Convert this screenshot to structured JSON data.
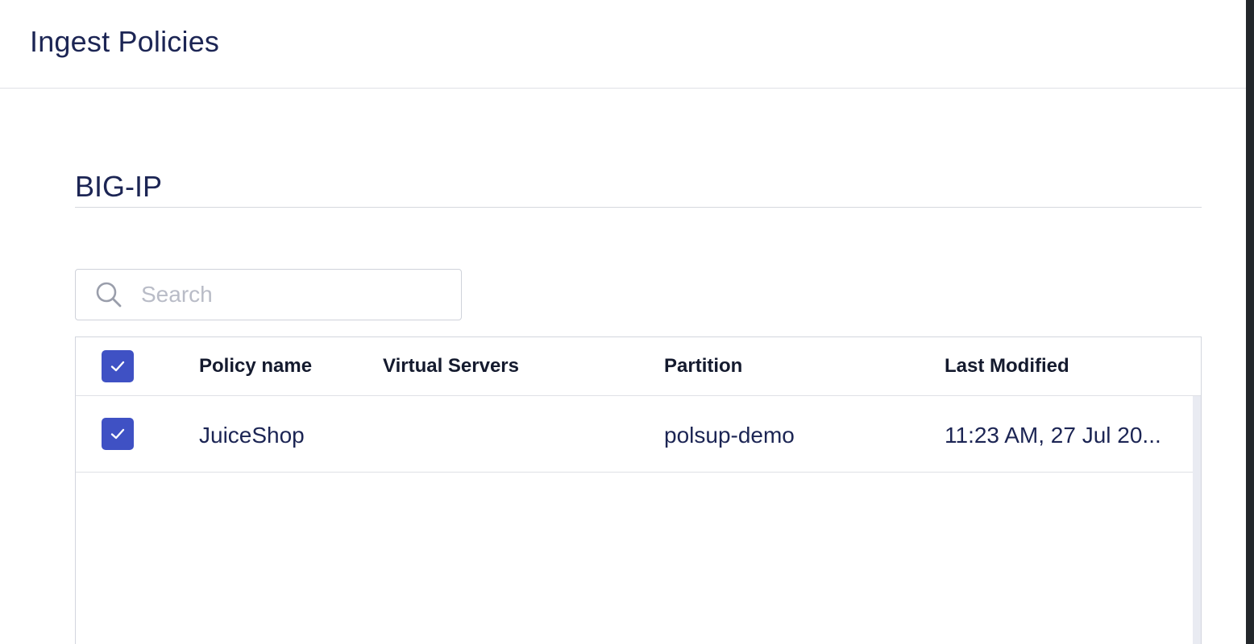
{
  "header": {
    "title": "Ingest Policies"
  },
  "section": {
    "title": "BIG-IP"
  },
  "search": {
    "placeholder": "Search",
    "value": ""
  },
  "table": {
    "columns": [
      "Policy name",
      "Virtual Servers",
      "Partition",
      "Last Modified"
    ],
    "select_all_checked": true,
    "rows": [
      {
        "checked": true,
        "policy_name": "JuiceShop",
        "virtual_servers": "",
        "partition": "polsup-demo",
        "last_modified": "11:23 AM, 27 Jul 20..."
      }
    ]
  },
  "colors": {
    "accent": "#3f51c4",
    "text_primary": "#1c2554",
    "header_text": "#141a2e",
    "border": "#d3d6de",
    "placeholder": "#b9bcc7"
  },
  "icons": {
    "search": "search-icon",
    "check": "check-icon"
  }
}
